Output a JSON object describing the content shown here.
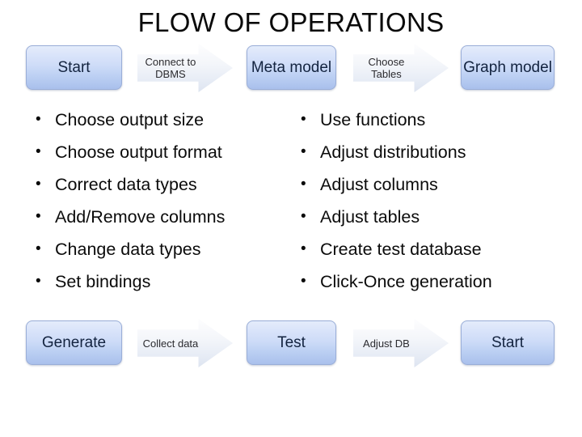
{
  "slide": {
    "title": "FLOW OF OPERATIONS",
    "background_color": "#ffffff"
  },
  "colors": {
    "box_fill_top": "#e4ecfb",
    "box_fill_bottom": "#a9c0ec",
    "box_border": "#9aaed8",
    "arrow_fill_top": "#fdfdfe",
    "arrow_fill_bottom": "#dde4f0",
    "text": "#0b0b0b",
    "box_text": "#13233f"
  },
  "top_flow": {
    "steps": [
      {
        "kind": "box",
        "label": "Start"
      },
      {
        "kind": "arrow",
        "label": "Connect to DBMS"
      },
      {
        "kind": "box",
        "label": "Meta model"
      },
      {
        "kind": "arrow",
        "label": "Choose Tables"
      },
      {
        "kind": "box",
        "label": "Graph model"
      }
    ]
  },
  "bottom_flow": {
    "steps": [
      {
        "kind": "box",
        "label": "Generate"
      },
      {
        "kind": "arrow",
        "label": "Collect data"
      },
      {
        "kind": "box",
        "label": "Test"
      },
      {
        "kind": "arrow",
        "label": "Adjust DB"
      },
      {
        "kind": "box",
        "label": "Start"
      }
    ]
  },
  "bullet_columns": {
    "bullet_char": "•",
    "left": [
      "Choose output size",
      "Choose output format",
      "Correct data types",
      "Add/Remove columns",
      "Change data types",
      "Set bindings"
    ],
    "right": [
      "Use functions",
      "Adjust distributions",
      "Adjust columns",
      "Adjust tables",
      "Create test database",
      "Click-Once generation"
    ]
  }
}
